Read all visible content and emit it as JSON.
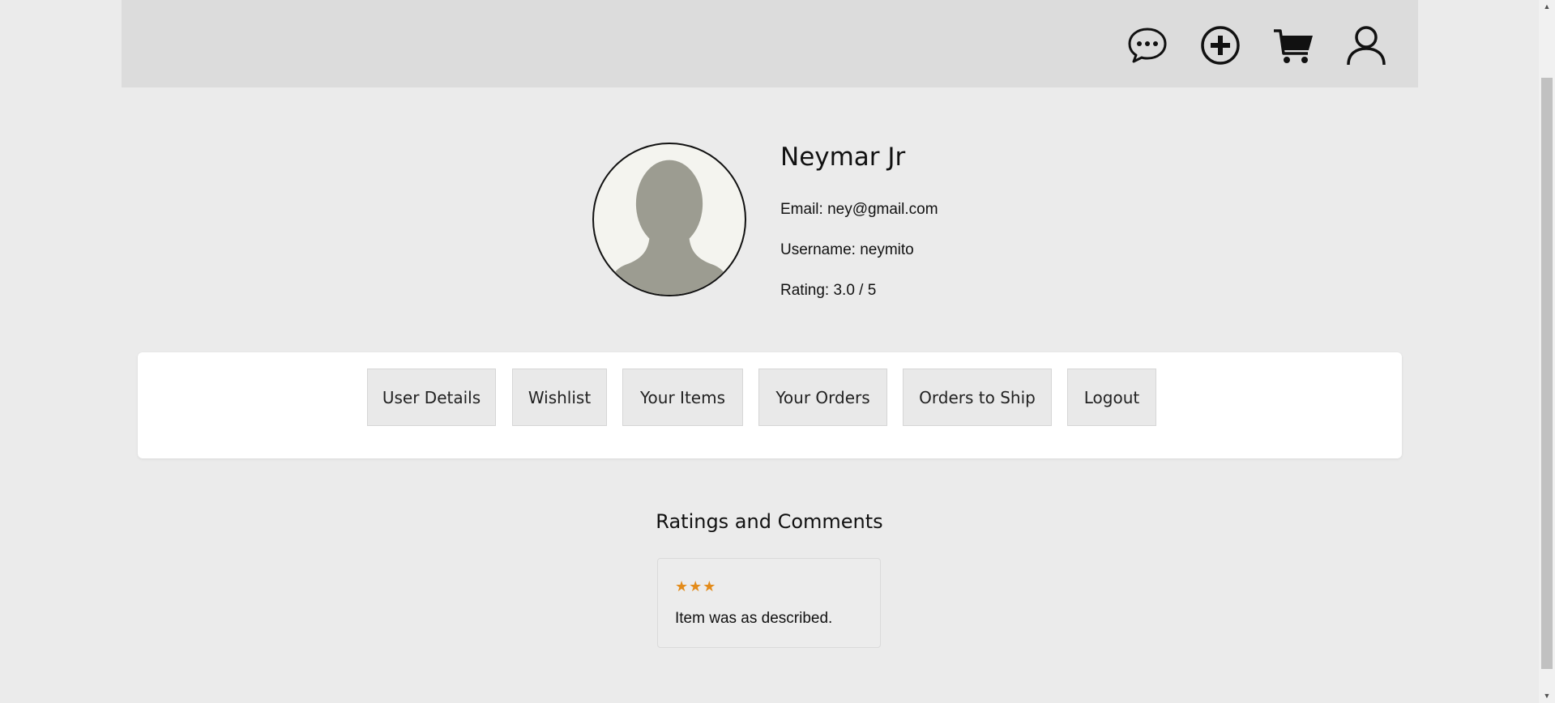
{
  "header": {
    "icons": [
      {
        "name": "chat-icon"
      },
      {
        "name": "add-icon"
      },
      {
        "name": "cart-icon"
      },
      {
        "name": "user-icon"
      }
    ]
  },
  "profile": {
    "name": "Neymar Jr",
    "email": "Email: ney@gmail.com",
    "username": "Username: neymito",
    "rating": "Rating: 3.0 / 5"
  },
  "tabs": [
    {
      "label": "User Details"
    },
    {
      "label": "Wishlist"
    },
    {
      "label": "Your Items"
    },
    {
      "label": "Your Orders"
    },
    {
      "label": "Orders to Ship"
    },
    {
      "label": "Logout"
    }
  ],
  "ratings_section": {
    "title": "Ratings and Comments",
    "comments": [
      {
        "stars": "★★★",
        "text": "Item was as described."
      }
    ]
  },
  "colors": {
    "star": "#e38b1a",
    "topbar": "#dcdcdc",
    "background": "#ebebeb"
  }
}
